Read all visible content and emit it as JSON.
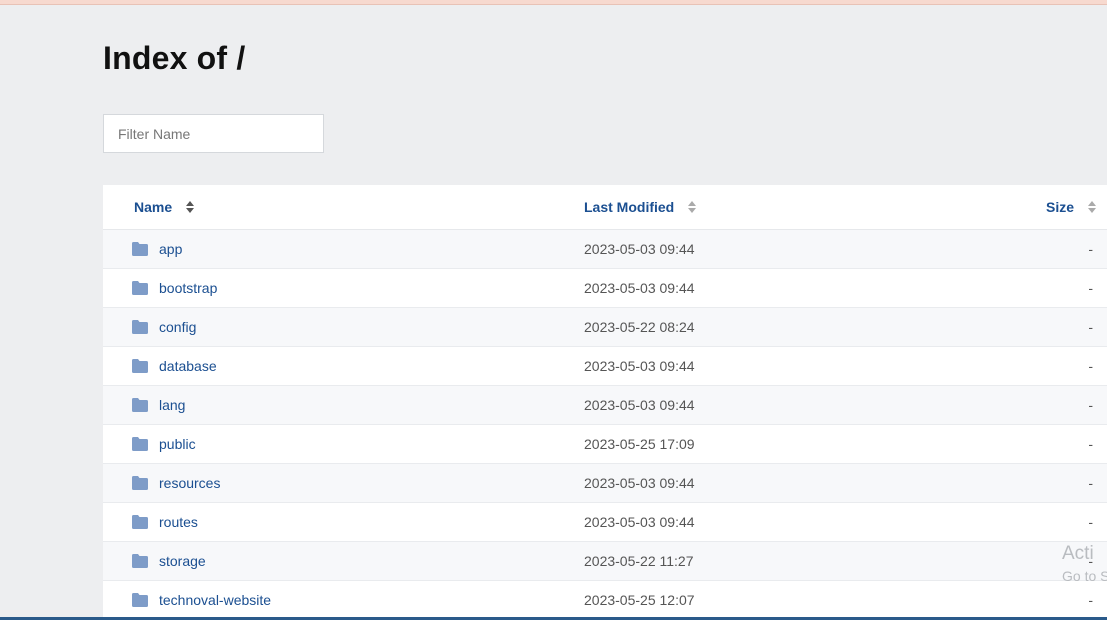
{
  "page": {
    "title": "Index of /"
  },
  "filter": {
    "placeholder": "Filter Name",
    "value": ""
  },
  "table": {
    "columns": {
      "name": "Name",
      "modified": "Last Modified",
      "size": "Size"
    },
    "rows": [
      {
        "name": "app",
        "modified": "2023-05-03 09:44",
        "size": "-",
        "icon": "folder-icon"
      },
      {
        "name": "bootstrap",
        "modified": "2023-05-03 09:44",
        "size": "-",
        "icon": "folder-icon"
      },
      {
        "name": "config",
        "modified": "2023-05-22 08:24",
        "size": "-",
        "icon": "folder-icon"
      },
      {
        "name": "database",
        "modified": "2023-05-03 09:44",
        "size": "-",
        "icon": "folder-icon"
      },
      {
        "name": "lang",
        "modified": "2023-05-03 09:44",
        "size": "-",
        "icon": "folder-icon"
      },
      {
        "name": "public",
        "modified": "2023-05-25 17:09",
        "size": "-",
        "icon": "folder-icon"
      },
      {
        "name": "resources",
        "modified": "2023-05-03 09:44",
        "size": "-",
        "icon": "folder-icon"
      },
      {
        "name": "routes",
        "modified": "2023-05-03 09:44",
        "size": "-",
        "icon": "folder-icon"
      },
      {
        "name": "storage",
        "modified": "2023-05-22 11:27",
        "size": "-",
        "icon": "folder-icon"
      },
      {
        "name": "technoval-website",
        "modified": "2023-05-25 12:07",
        "size": "-",
        "icon": "folder-icon"
      }
    ]
  },
  "overlay": {
    "line1": "Acti",
    "line2": "Go to S"
  },
  "colors": {
    "link": "#1b4f91",
    "folder": "#7e9cc8",
    "background": "#edeef0"
  }
}
